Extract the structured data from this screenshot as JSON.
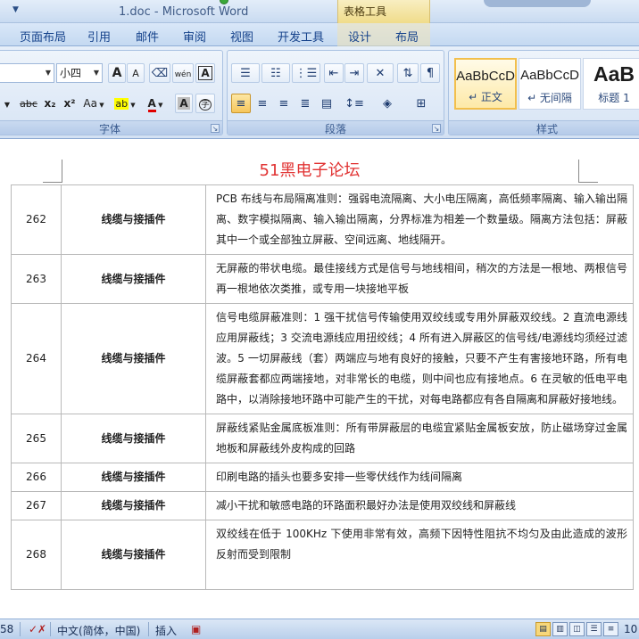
{
  "window": {
    "title": "1.doc - Microsoft Word",
    "qat_menu_icon": "dropdown-arrow-icon",
    "context_group": "表格工具"
  },
  "tabs": [
    {
      "label": "页面布局"
    },
    {
      "label": "引用"
    },
    {
      "label": "邮件"
    },
    {
      "label": "审阅"
    },
    {
      "label": "视图"
    },
    {
      "label": "开发工具"
    },
    {
      "label": "设计"
    },
    {
      "label": "布局"
    }
  ],
  "ribbon": {
    "font": {
      "font_size": "小四",
      "grow": "A",
      "shrink": "A",
      "phonetic": "wén",
      "strikethrough": "abc",
      "subscript": "x₂",
      "superscript": "x²",
      "change_case": "Aa",
      "highlight": "ab",
      "font_color": "A",
      "char_shading": "A",
      "enclose": "字",
      "char_border": "A",
      "label": "字体"
    },
    "paragraph": {
      "label": "段落"
    },
    "styles": {
      "label": "样式",
      "items": [
        {
          "sample": "AaBbCcD",
          "name": "↵ 正文"
        },
        {
          "sample": "AaBbCcD",
          "name": "↵ 无间隔"
        },
        {
          "sample": "AaB",
          "name": "标题 1"
        }
      ]
    }
  },
  "document": {
    "header_text": "51黑电子论坛",
    "rows": [
      {
        "num": "262",
        "cat": "线缆与接插件",
        "text": "PCB 布线与布局隔离准则：强弱电流隔离、大小电压隔离，高低频率隔离、输入输出隔离、数字模拟隔离、输入输出隔离，分界标准为相差一个数量级。隔离方法包括：屏蔽其中一个或全部独立屏蔽、空间远离、地线隔开。"
      },
      {
        "num": "263",
        "cat": "线缆与接插件",
        "text": "无屏蔽的带状电缆。最佳接线方式是信号与地线相间，稍次的方法是一根地、两根信号再一根地依次类推，或专用一块接地平板"
      },
      {
        "num": "264",
        "cat": "线缆与接插件",
        "text": "信号电缆屏蔽准则：1 强干扰信号传输使用双绞线或专用外屏蔽双绞线。2 直流电源线应用屏蔽线；3 交流电源线应用扭绞线；4 所有进入屏蔽区的信号线/电源线均须经过滤波。5 一切屏蔽线（套）两端应与地有良好的接触，只要不产生有害接地环路，所有电缆屏蔽套都应两端接地，对非常长的电缆，则中间也应有接地点。6 在灵敏的低电平电路中，以消除接地环路中可能产生的干扰，对每电路都应有各自隔离和屏蔽好接地线。"
      },
      {
        "num": "265",
        "cat": "线缆与接插件",
        "text": "屏蔽线紧贴金属底板准则：所有带屏蔽层的电缆宜紧贴金属板安放，防止磁场穿过金属地板和屏蔽线外皮构成的回路"
      },
      {
        "num": "266",
        "cat": "线缆与接插件",
        "text": "印刷电路的插头也要多安排一些零伏线作为线间隔离"
      },
      {
        "num": "267",
        "cat": "线缆与接插件",
        "text": "减小干扰和敏感电路的环路面积最好办法是使用双绞线和屏蔽线"
      },
      {
        "num": "268",
        "cat": "线缆与接插件",
        "text": "双绞线在低于 100KHz 下使用非常有效，高频下因特性阻抗不均匀及由此造成的波形反射而受到限制"
      }
    ]
  },
  "statusbar": {
    "page_fragment": "58",
    "language": "中文(简体，中国)",
    "mode": "插入",
    "zoom_fragment": "10"
  }
}
